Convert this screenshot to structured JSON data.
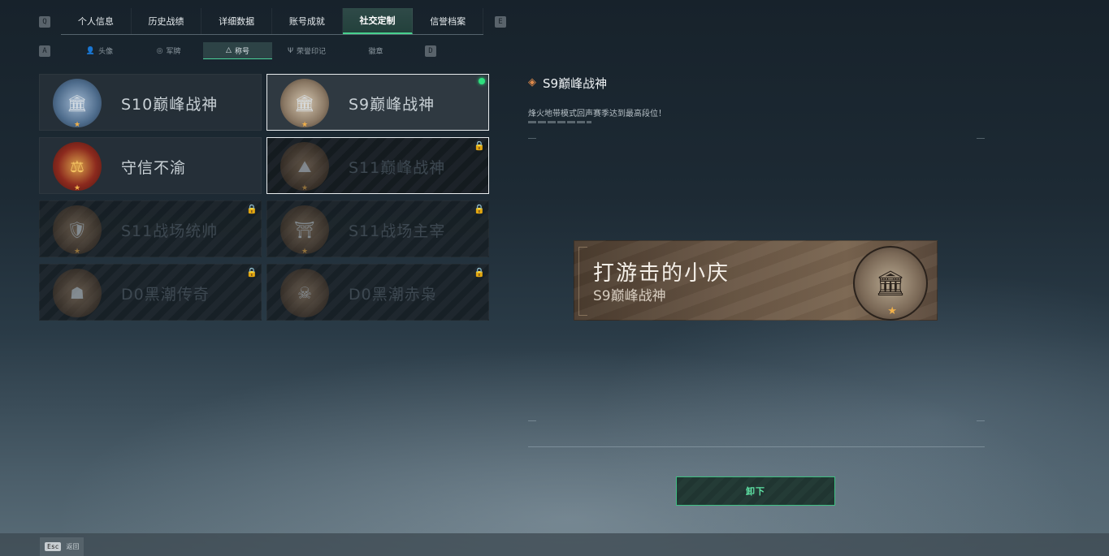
{
  "top_tabs": {
    "left_key": "Q",
    "right_key": "E",
    "items": [
      "个人信息",
      "历史战绩",
      "详细数据",
      "账号成就",
      "社交定制",
      "信誉档案"
    ],
    "active_index": 4
  },
  "sub_tabs": {
    "left_key": "A",
    "right_key": "D",
    "items": [
      {
        "label": "头像",
        "icon": "person-icon"
      },
      {
        "label": "军牌",
        "icon": "dogtag-icon"
      },
      {
        "label": "称号",
        "icon": "title-icon"
      },
      {
        "label": "荣誉印记",
        "icon": "honor-mark-icon"
      },
      {
        "label": "徽章",
        "icon": ""
      }
    ],
    "active_index": 2
  },
  "titles": [
    {
      "label": "S10巅峰战神",
      "state": "unlocked",
      "emblem_color": "#4e6c8c"
    },
    {
      "label": "S9巅峰战神",
      "state": "equipped",
      "emblem_color": "#8a7864"
    },
    {
      "label": "守信不渝",
      "state": "unlocked",
      "emblem_color": "#8c2a1e"
    },
    {
      "label": "S11巅峰战神",
      "state": "locked-selected",
      "emblem_color": "#5a4634"
    },
    {
      "label": "S11战场统帅",
      "state": "locked",
      "emblem_color": "#5a4634"
    },
    {
      "label": "S11战场主宰",
      "state": "locked",
      "emblem_color": "#5a4634"
    },
    {
      "label": "D0黑潮传奇",
      "state": "locked",
      "emblem_color": "#5a4634"
    },
    {
      "label": "D0黑潮赤枭",
      "state": "locked",
      "emblem_color": "#5a4634"
    }
  ],
  "detail": {
    "title": "S9巅峰战神",
    "description": "烽火地带模式回声赛季达到最高段位！"
  },
  "banner": {
    "player_name": "打游击的小庆",
    "title": "S9巅峰战神"
  },
  "unequip_label": "卸下",
  "esc": {
    "key": "Esc",
    "label": "返回"
  },
  "colors": {
    "accent": "#47d08d",
    "equipped": "#2fe07f",
    "star": "#f0b04a"
  }
}
